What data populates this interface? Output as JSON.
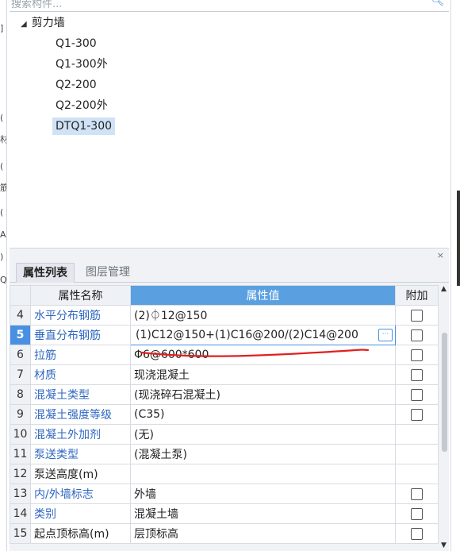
{
  "search": {
    "placeholder": "搜索构件...",
    "icon": "search-icon"
  },
  "left_edge_chars": [
    "]",
    "(",
    "(",
    "材",
    "(",
    "筋",
    "(",
    "A)",
    ")",
    "Q"
  ],
  "tree": {
    "root": "剪力墙",
    "items": [
      "Q1-300",
      "Q1-300外",
      "Q2-200",
      "Q2-200外",
      "DTQ1-300"
    ],
    "selected": "DTQ1-300"
  },
  "panel": {
    "close_label": "×",
    "tabs": [
      {
        "label": "属性列表",
        "active": true
      },
      {
        "label": "图层管理",
        "active": false
      }
    ],
    "columns": {
      "name": "属性名称",
      "value": "属性值",
      "extra": "附加"
    },
    "rows": [
      {
        "num": "4",
        "name": "水平分布钢筋",
        "value": "(2)⏀12@150",
        "link": true,
        "check": true,
        "selected": false
      },
      {
        "num": "5",
        "name": "垂直分布钢筋",
        "value": "(1)C12@150+(1)C16@200/(2)C14@200",
        "link": true,
        "check": true,
        "selected": true
      },
      {
        "num": "6",
        "name": "拉筋",
        "value": "Φ6@600*600",
        "link": true,
        "check": true,
        "selected": false
      },
      {
        "num": "7",
        "name": "材质",
        "value": "现浇混凝土",
        "link": true,
        "check": true,
        "selected": false
      },
      {
        "num": "8",
        "name": "混凝土类型",
        "value": "(现浇碎石混凝土)",
        "link": true,
        "check": true,
        "selected": false
      },
      {
        "num": "9",
        "name": "混凝土强度等级",
        "value": "(C35)",
        "link": true,
        "check": true,
        "selected": false
      },
      {
        "num": "10",
        "name": "混凝土外加剂",
        "value": "(无)",
        "link": true,
        "check": false,
        "selected": false
      },
      {
        "num": "11",
        "name": "泵送类型",
        "value": "(混凝土泵)",
        "link": true,
        "check": false,
        "selected": false
      },
      {
        "num": "12",
        "name": "泵送高度(m)",
        "value": "",
        "link": false,
        "check": false,
        "selected": false
      },
      {
        "num": "13",
        "name": "内/外墙标志",
        "value": "外墙",
        "link": true,
        "check": true,
        "selected": false
      },
      {
        "num": "14",
        "name": "类别",
        "value": "混凝土墙",
        "link": true,
        "check": true,
        "selected": false
      },
      {
        "num": "15",
        "name": "起点顶标高(m)",
        "value": "层顶标高",
        "link": false,
        "check": true,
        "selected": false
      }
    ],
    "edit_button_label": "···"
  },
  "colors": {
    "accent": "#4a90e2",
    "link": "#2f67c0",
    "annotation": "#e02020",
    "selected_tree": "#cfe2f6"
  }
}
